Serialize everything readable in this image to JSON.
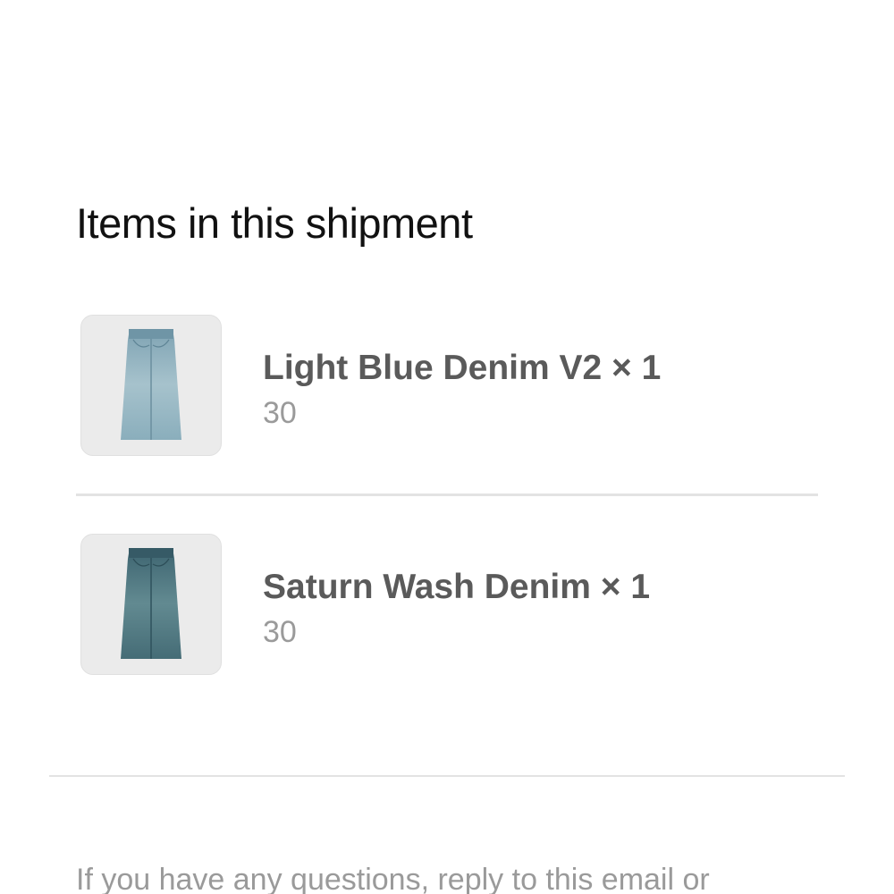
{
  "shipment": {
    "title": "Items in this shipment",
    "items": [
      {
        "name": "Light Blue Denim V2 × 1",
        "variant": "30",
        "image": "light-blue-denim-skirt",
        "color": "#8fb0bf"
      },
      {
        "name": "Saturn Wash Denim × 1",
        "variant": "30",
        "image": "saturn-wash-denim-skirt",
        "color": "#4f7680"
      }
    ]
  },
  "footer": {
    "text": "If you have any questions, reply to this email or"
  },
  "colors": {
    "title": "#111111",
    "item_name": "#5a5a5a",
    "item_variant": "#9a9a9a",
    "divider": "#e3e3e3",
    "thumb_bg": "#ebebeb"
  }
}
